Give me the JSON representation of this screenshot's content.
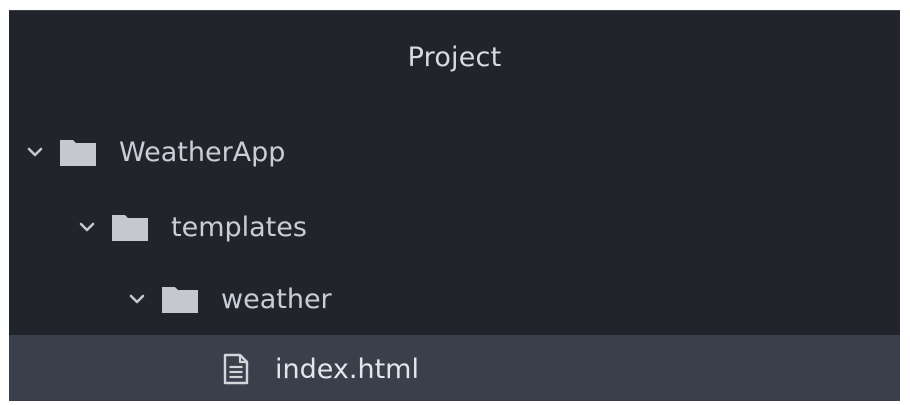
{
  "panel": {
    "title": "Project"
  },
  "tree": {
    "items": [
      {
        "label": "WeatherApp",
        "type": "folder",
        "expanded": true,
        "depth": 0,
        "icon": "folder-icon"
      },
      {
        "label": "templates",
        "type": "folder",
        "expanded": true,
        "depth": 1,
        "icon": "folder-icon"
      },
      {
        "label": "weather",
        "type": "folder",
        "expanded": true,
        "depth": 2,
        "icon": "folder-icon"
      },
      {
        "label": "index.html",
        "type": "file",
        "selected": true,
        "depth": 3,
        "icon": "file-text-icon"
      }
    ]
  },
  "colors": {
    "panel_bg": "#21252b",
    "selected_bg": "#3a3f4b",
    "text": "#c9ced6",
    "icon": "#c5c8ce"
  }
}
